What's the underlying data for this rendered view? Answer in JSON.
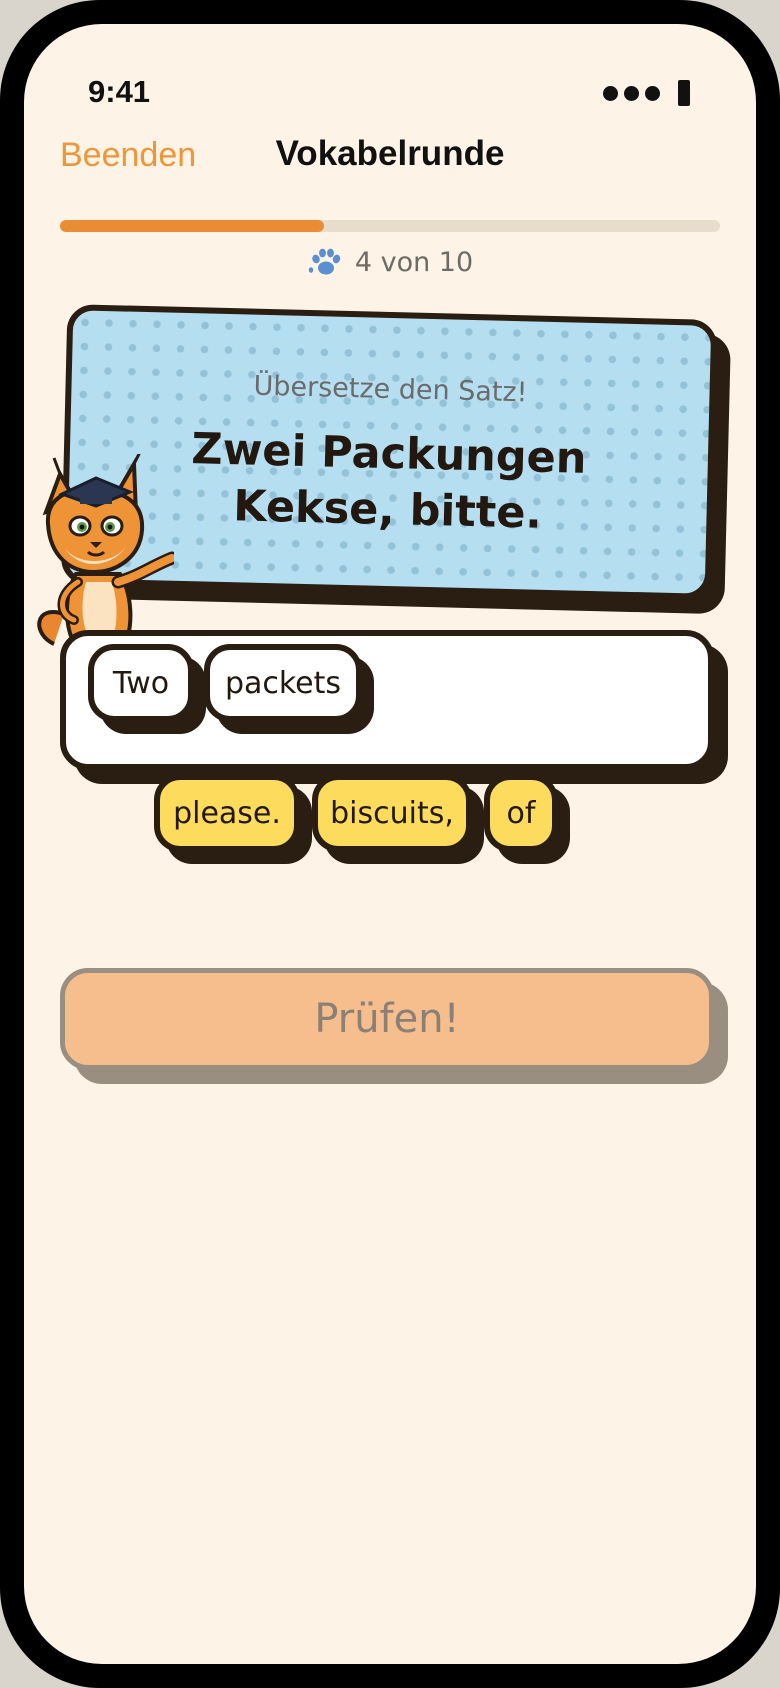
{
  "status_bar": {
    "time": "9:41"
  },
  "nav": {
    "quit_label": "Beenden",
    "title": "Vokabelrunde"
  },
  "progress": {
    "current": 4,
    "total": 10,
    "fraction": 0.4,
    "label": "4 von 10",
    "icon": "paw-icon"
  },
  "prompt": {
    "instruction": "Übersetze den Satz!",
    "sentence": "Zwei Packungen Kekse, bitte."
  },
  "answer": {
    "selected_words": [
      "Two",
      "packets"
    ]
  },
  "word_bank": [
    "please.",
    "biscuits,",
    "of"
  ],
  "check_button": {
    "label": "Prüfen!"
  },
  "colors": {
    "accent": "#ea8b35",
    "background": "#fdf3e6",
    "card": "#b5def0",
    "chip_available": "#fddc5d",
    "outline": "#2a1d12",
    "button_disabled": "#f6be8d"
  },
  "mascot": {
    "icon": "lynx-mascot-icon"
  }
}
